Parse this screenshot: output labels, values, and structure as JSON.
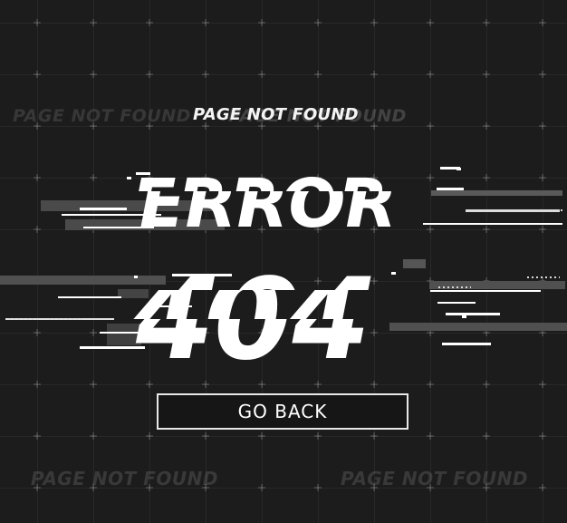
{
  "page": {
    "subtitle": "PAGE NOT FOUND",
    "headline": "ERROR",
    "code": "404",
    "ghost_texts": [
      "PAGE NOT FOUND",
      "PAGE NOT FOUND",
      "PAGE NOT FOUND",
      "PAGE NOT FOUND"
    ]
  },
  "actions": {
    "go_back_label": "GO BACK"
  },
  "colors": {
    "background": "#1c1c1c",
    "text": "#ffffff",
    "ghost": "#3a3a3a"
  }
}
